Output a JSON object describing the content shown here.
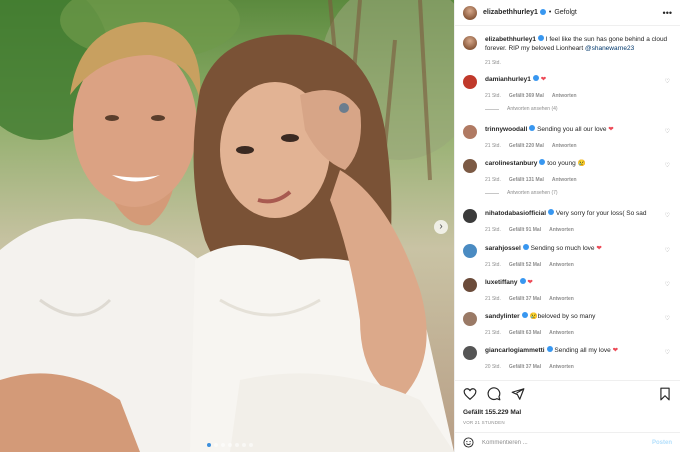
{
  "post": {
    "author": "elizabethhurley1",
    "follow_state": "Gefolgt",
    "caption": "I feel like the sun has gone behind a cloud forever. RIP my beloved Lionheart",
    "caption_mention": "@shanewarne23",
    "caption_time": "21 Std."
  },
  "comments": [
    {
      "user": "damianhurley1",
      "text": "❤️",
      "time": "21 Std.",
      "likes": "Gefällt 369 Mal",
      "reply": "Antworten",
      "verified": true,
      "avatar_color": "#c0392b",
      "view_replies": "Antworten ansehen (4)"
    },
    {
      "user": "trinnywoodall",
      "text": "Sending you all our love ❤️",
      "time": "21 Std.",
      "likes": "Gefällt 220 Mal",
      "reply": "Antworten",
      "verified": true,
      "avatar_color": "#b07a63"
    },
    {
      "user": "carolinestanbury",
      "text": "too young 😢",
      "time": "21 Std.",
      "likes": "Gefällt 131 Mal",
      "reply": "Antworten",
      "verified": true,
      "avatar_color": "#7c5a44",
      "view_replies": "Antworten ansehen (7)"
    },
    {
      "user": "nihatodabasiofficial",
      "text": "Very sorry for your loss( So sad",
      "time": "21 Std.",
      "likes": "Gefällt 91 Mal",
      "reply": "Antworten",
      "verified": true,
      "avatar_color": "#3b3b3b"
    },
    {
      "user": "sarahjossel",
      "text": "Sending so much love ❤️",
      "time": "21 Std.",
      "likes": "Gefällt 52 Mal",
      "reply": "Antworten",
      "verified": true,
      "avatar_color": "#4a8bc2"
    },
    {
      "user": "luxetiffany",
      "text": "❤️",
      "time": "21 Std.",
      "likes": "Gefällt 37 Mal",
      "reply": "Antworten",
      "verified": true,
      "avatar_color": "#6b4b3a"
    },
    {
      "user": "sandylinter",
      "text": "😢beloved by so many",
      "time": "21 Std.",
      "likes": "Gefällt 63 Mal",
      "reply": "Antworten",
      "verified": true,
      "avatar_color": "#9a7a66"
    },
    {
      "user": "giancarlogiammetti",
      "text": "Sending all my love ❤️",
      "time": "20 Std.",
      "likes": "Gefällt 37 Mal",
      "reply": "Antworten",
      "verified": true,
      "avatar_color": "#555555"
    }
  ],
  "actions": {
    "likes": "Gefällt 155.229 Mal",
    "time": "VOR 21 STUNDEN"
  },
  "comment_box": {
    "placeholder": "Kommentieren ...",
    "post_label": "Posten"
  },
  "carousel": {
    "count": 7,
    "active": 0
  },
  "colors": {
    "verified": "#3897f0",
    "heart": "#ed4956",
    "link": "#00376b",
    "muted": "#8e8e8e"
  }
}
